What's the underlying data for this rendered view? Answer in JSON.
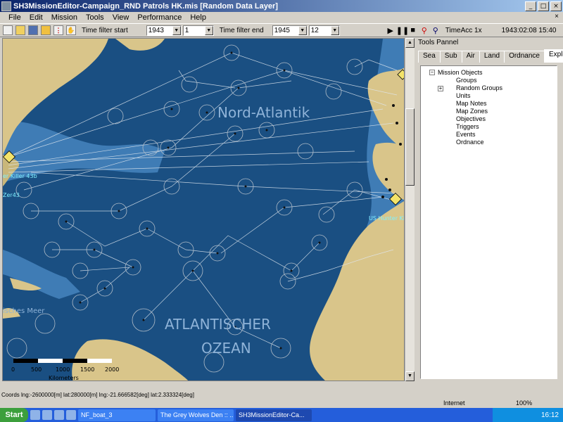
{
  "window": {
    "title": "SH3MissionEditor-Campaign_RND Patrols HK.mis [Random Data Layer]",
    "minimize": "_",
    "maximize": "□",
    "close": "×"
  },
  "menu": [
    "File",
    "Edit",
    "Mission",
    "Tools",
    "View",
    "Performance",
    "Help"
  ],
  "menu_close": "×",
  "toolbar": {
    "filter_start_label": "Time filter start",
    "filter_start_year": "1943",
    "filter_start_month": "1",
    "filter_end_label": "Time filter end",
    "filter_end_year": "1945",
    "filter_end_month": "12",
    "time_acc": "TimeAcc 1x",
    "datetime": "1943:02:08 15:40"
  },
  "map": {
    "labels": {
      "nord_atlantik": "Nord-Atlantik",
      "atlantischer": "ATLANTISCHER",
      "ozean": "OZEAN",
      "sches_meer": "isches Meer",
      "hunter_killer_43b": "er Killer 43b",
      "zer43": "Zer43",
      "us_hunter_killer": "US Hunter Kille"
    },
    "scale": {
      "ticks": [
        "0",
        "500",
        "1000",
        "1500",
        "2000"
      ],
      "unit": "Kilometers"
    }
  },
  "tools_panel": {
    "title": "Tools Pannel",
    "tabs": [
      "Sea",
      "Sub",
      "Air",
      "Land",
      "Ordnance",
      "Explorer"
    ],
    "active_tab": "Explorer",
    "tree": {
      "root": "Mission Objects",
      "children": [
        "Groups",
        "Random Groups",
        "Units",
        "Map Notes",
        "Map Zones",
        "Objectives",
        "Triggers",
        "Events",
        "Ordnance"
      ]
    }
  },
  "status": {
    "coords": "Coords lng:-2600000[m] lat:280000[m]   lng:-21.666582[deg] lat:2.333324[deg]",
    "internet": "Internet",
    "zoom": "100%"
  },
  "taskbar": {
    "start": "Start",
    "tasks": [
      "NF_boat_3",
      "The Grey Wolves Den :: ...",
      "SH3MissionEditor-Ca..."
    ],
    "clock": "16:12"
  },
  "colors": {
    "ocean": "#1a4f82",
    "shelf": "#3f7cb5",
    "land": "#d9c58a",
    "titlebar": "#0a246a"
  }
}
